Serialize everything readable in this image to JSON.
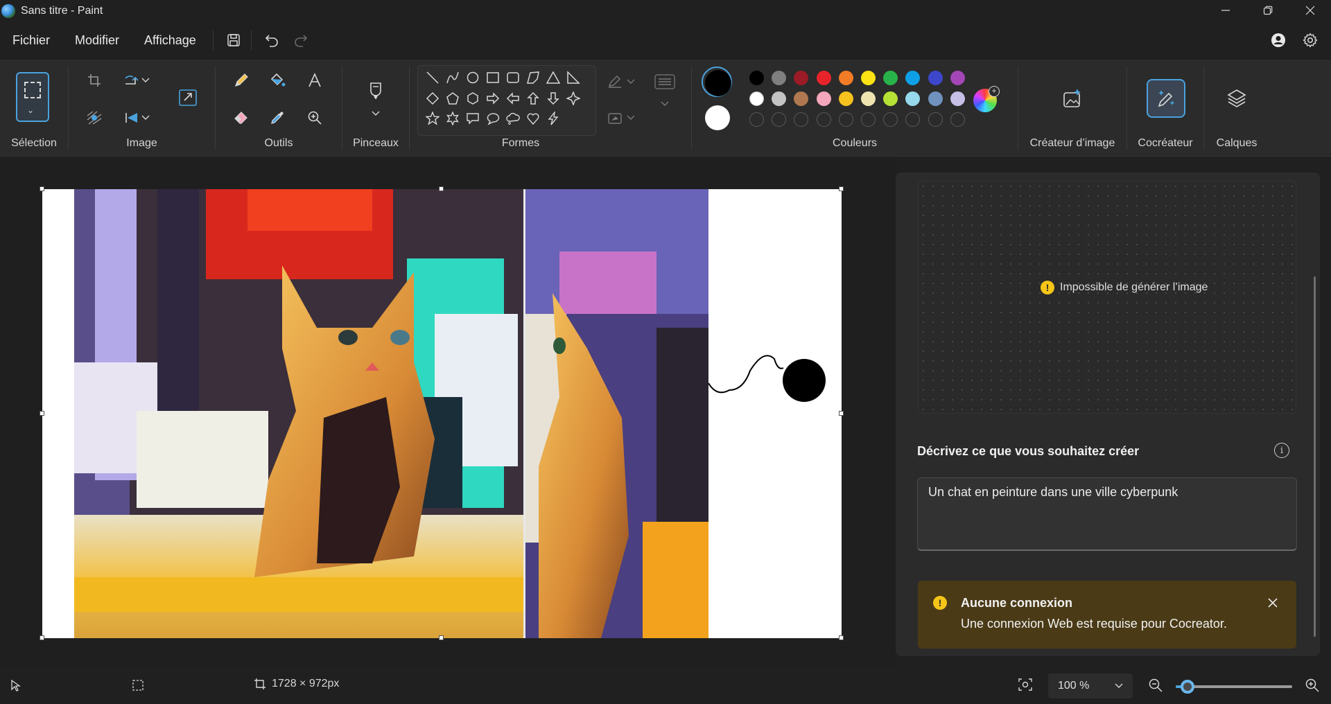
{
  "window": {
    "title": "Sans titre - Paint"
  },
  "menu": {
    "items": [
      "Fichier",
      "Modifier",
      "Affichage"
    ]
  },
  "ribbon": {
    "groups": {
      "selection": "Sélection",
      "image": "Image",
      "tools": "Outils",
      "brushes": "Pinceaux",
      "shapes": "Formes",
      "colors": "Couleurs",
      "image_creator": "Créateur d’image",
      "cocreator": "Cocréateur",
      "layers": "Calques"
    },
    "palette": {
      "row1": [
        "#000000",
        "#7f7f7f",
        "#9b1c26",
        "#e8242a",
        "#f57c26",
        "#fbe314",
        "#28b34a",
        "#0ea0e6",
        "#3c47cc",
        "#a446b7"
      ],
      "row2": [
        "#ffffff",
        "#c3c3c3",
        "#b07850",
        "#f4a6bd",
        "#f6c21e",
        "#efe3b0",
        "#b6e236",
        "#96d8ec",
        "#7092be",
        "#c8bfe7"
      ],
      "empty_slots": 10
    },
    "primary_color": "#000000",
    "secondary_color": "#ffffff"
  },
  "panel": {
    "error_message": "Impossible de générer l’image",
    "describe_label": "Décrivez ce que vous souhaitez créer",
    "prompt_value": "Un chat en peinture dans une ville cyberpunk"
  },
  "toast": {
    "title": "Aucune connexion",
    "body": "Une connexion Web est requise pour Cocreator."
  },
  "status": {
    "canvas_size": "1728 × 972px",
    "zoom": "100 %",
    "zoom_fraction": 0.1
  }
}
